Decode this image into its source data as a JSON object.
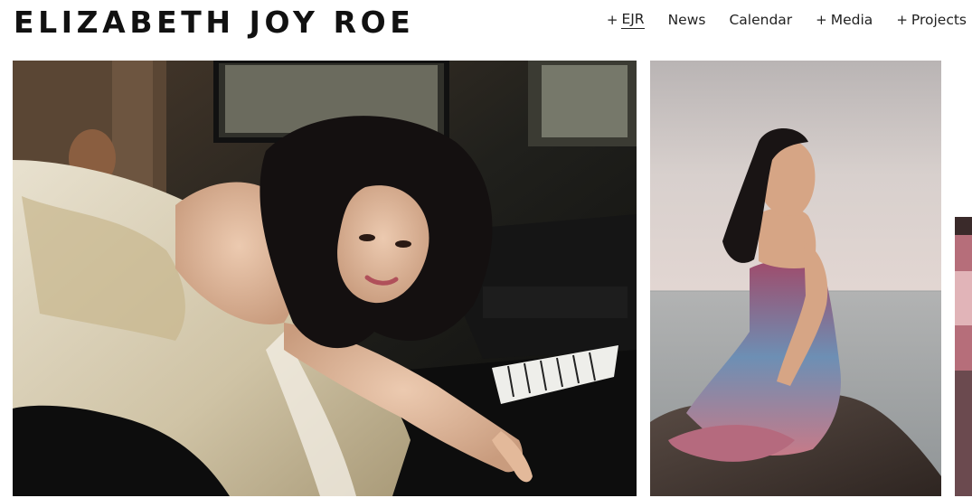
{
  "header": {
    "site_title": "ELIZABETH JOY ROE"
  },
  "nav": {
    "items": [
      {
        "label": "EJR",
        "expandable": true,
        "active": true
      },
      {
        "label": "News",
        "expandable": false,
        "active": false
      },
      {
        "label": "Calendar",
        "expandable": false,
        "active": false
      },
      {
        "label": "Media",
        "expandable": true,
        "active": false
      },
      {
        "label": "Projects",
        "expandable": true,
        "active": false
      }
    ],
    "expand_symbol": "+"
  },
  "colors": {
    "background": "#ffffff",
    "text": "#111111"
  }
}
